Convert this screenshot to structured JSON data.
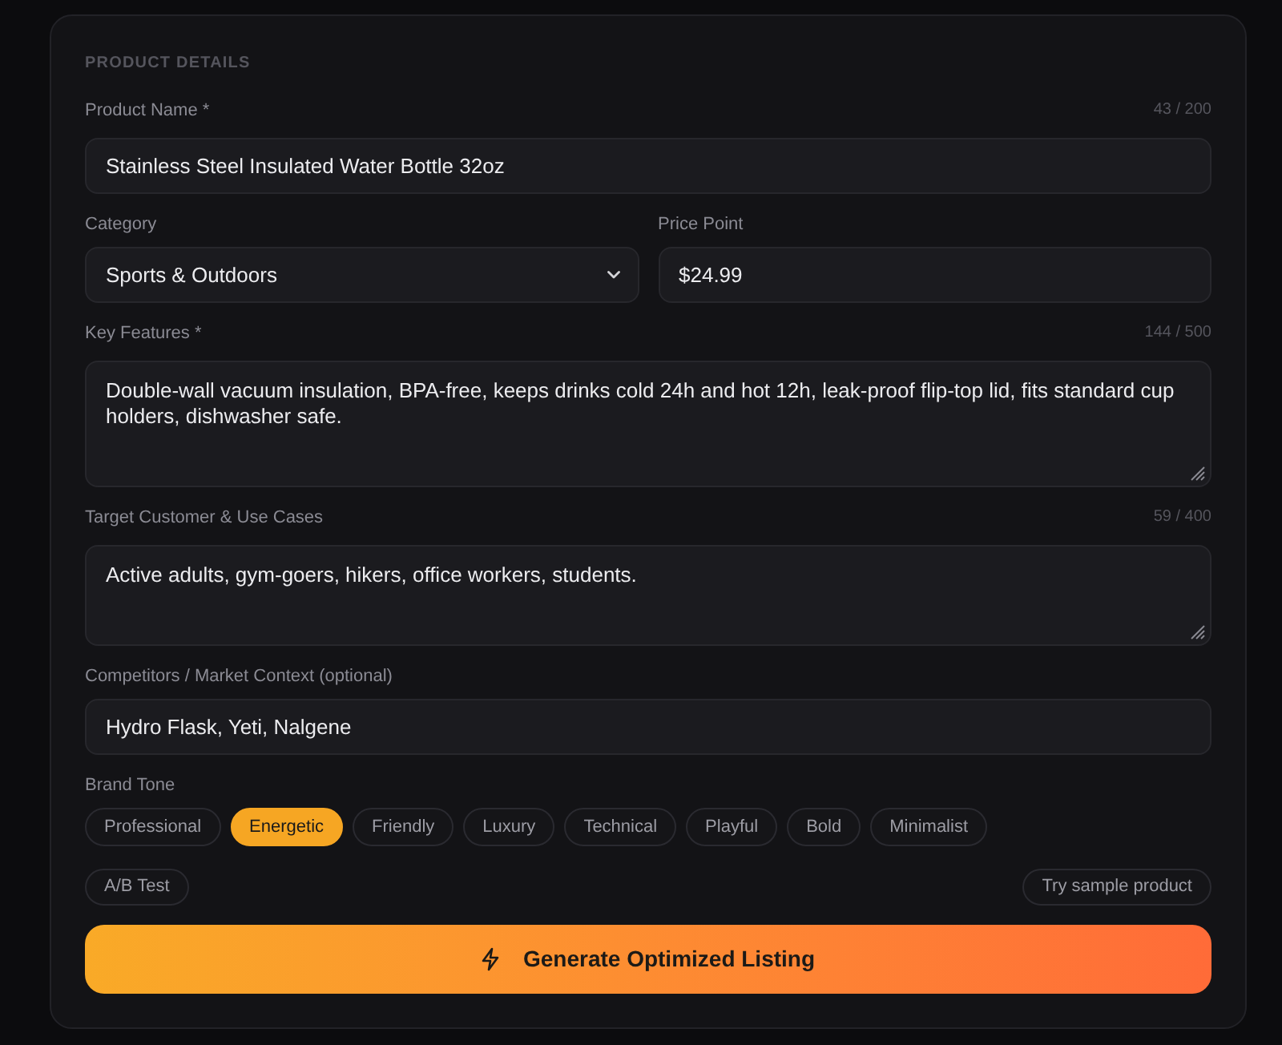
{
  "section_title": "PRODUCT DETAILS",
  "rows": [
    {
      "fields": [
        {
          "kind": "text",
          "label": "Product Name *",
          "counter": "43 / 200",
          "value": "Stainless Steel Insulated Water Bottle 32oz"
        }
      ]
    },
    {
      "fields": [
        {
          "kind": "select",
          "label": "Category",
          "value": "Sports & Outdoors"
        },
        {
          "kind": "text",
          "label": "Price Point",
          "value": "$24.99"
        }
      ]
    },
    {
      "fields": [
        {
          "kind": "textarea",
          "label": "Key Features *",
          "counter": "144 / 500",
          "value": "Double-wall vacuum insulation, BPA-free, keeps drinks cold 24h and hot 12h, leak-proof flip-top lid, fits standard cup holders, dishwasher safe."
        }
      ]
    },
    {
      "fields": [
        {
          "kind": "textarea",
          "label": "Target Customer & Use Cases",
          "counter": "59 / 400",
          "value": "Active adults, gym-goers, hikers, office workers, students."
        }
      ]
    },
    {
      "fields": [
        {
          "kind": "text",
          "label": "Competitors / Market Context (optional)",
          "value": "Hydro Flask, Yeti, Nalgene"
        }
      ]
    }
  ],
  "brand_tone": {
    "label": "Brand Tone",
    "options": [
      {
        "label": "Professional",
        "selected": false
      },
      {
        "label": "Energetic",
        "selected": true
      },
      {
        "label": "Friendly",
        "selected": false
      },
      {
        "label": "Luxury",
        "selected": false
      },
      {
        "label": "Technical",
        "selected": false
      },
      {
        "label": "Playful",
        "selected": false
      },
      {
        "label": "Bold",
        "selected": false
      },
      {
        "label": "Minimalist",
        "selected": false
      }
    ]
  },
  "ab_test_button": "A/B Test",
  "sample_button": "Try sample product",
  "generate_button": "Generate Optimized Listing"
}
